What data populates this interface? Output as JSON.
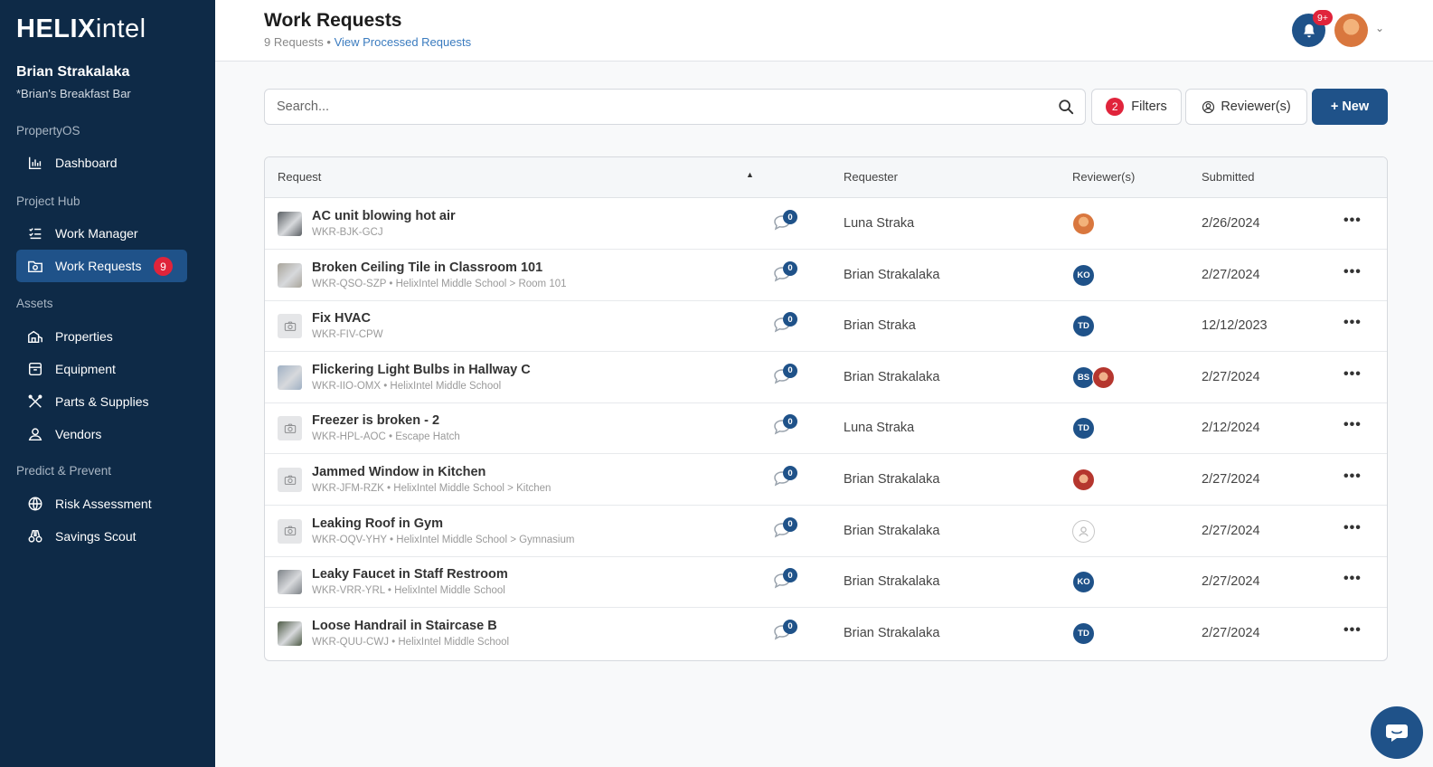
{
  "brand": {
    "logo_bold": "HELIX",
    "logo_light": "intel"
  },
  "user": {
    "name": "Brian Strakalaka",
    "org": "*Brian's Breakfast Bar"
  },
  "sidebar": {
    "sections": [
      "PropertyOS",
      "Project Hub",
      "Assets",
      "Predict & Prevent"
    ],
    "items": [
      {
        "label": "Dashboard",
        "icon": "chart-icon"
      },
      {
        "label": "Work Manager",
        "icon": "checklist-icon"
      },
      {
        "label": "Work Requests",
        "icon": "folder-camera-icon",
        "badge": "9",
        "active": true
      },
      {
        "label": "Properties",
        "icon": "buildings-icon"
      },
      {
        "label": "Equipment",
        "icon": "box-icon"
      },
      {
        "label": "Parts & Supplies",
        "icon": "tools-icon"
      },
      {
        "label": "Vendors",
        "icon": "person-icon"
      },
      {
        "label": "Risk Assessment",
        "icon": "globe-icon"
      },
      {
        "label": "Savings Scout",
        "icon": "binoculars-icon"
      }
    ]
  },
  "header": {
    "title": "Work Requests",
    "count": "9 Requests",
    "separator": "•",
    "processed_link": "View Processed Requests",
    "notif_badge": "9+"
  },
  "toolbar": {
    "search_placeholder": "Search...",
    "filters_count": "2",
    "filters_label": "Filters",
    "reviewers_label": "Reviewer(s)",
    "new_label": "+ New"
  },
  "table": {
    "columns": [
      "Request",
      "Requester",
      "Reviewer(s)",
      "Submitted"
    ],
    "rows": [
      {
        "title": "AC unit blowing hot air",
        "sub": "WKR-BJK-GCJ",
        "comments": "0",
        "requester": "Luna Straka",
        "reviewers": [
          {
            "type": "photo-a",
            "initials": ""
          }
        ],
        "submitted": "2/26/2024",
        "thumb": "photo",
        "thumb_color": "#5a5f63"
      },
      {
        "title": "Broken Ceiling Tile in Classroom 101",
        "sub": "WKR-QSO-SZP • HelixIntel Middle School > Room 101",
        "comments": "0",
        "requester": "Brian Strakalaka",
        "reviewers": [
          {
            "type": "initials",
            "initials": "KO"
          }
        ],
        "submitted": "2/27/2024",
        "thumb": "photo",
        "thumb_color": "#a8a49a"
      },
      {
        "title": "Fix HVAC",
        "sub": "WKR-FIV-CPW",
        "comments": "0",
        "requester": "Brian Straka",
        "reviewers": [
          {
            "type": "initials",
            "initials": "TD"
          }
        ],
        "submitted": "12/12/2023",
        "thumb": "placeholder",
        "thumb_color": "#e5e6e8"
      },
      {
        "title": "Flickering Light Bulbs in Hallway C",
        "sub": "WKR-IIO-OMX • HelixIntel Middle School",
        "comments": "0",
        "requester": "Brian Strakalaka",
        "reviewers": [
          {
            "type": "initials",
            "initials": "BS"
          },
          {
            "type": "photo-b",
            "initials": ""
          }
        ],
        "submitted": "2/27/2024",
        "thumb": "photo",
        "thumb_color": "#9fb0c4"
      },
      {
        "title": "Freezer is broken - 2",
        "sub": "WKR-HPL-AOC • Escape Hatch",
        "comments": "0",
        "requester": "Luna Straka",
        "reviewers": [
          {
            "type": "initials",
            "initials": "TD"
          }
        ],
        "submitted": "2/12/2024",
        "thumb": "placeholder",
        "thumb_color": "#e5e6e8"
      },
      {
        "title": "Jammed Window in Kitchen",
        "sub": "WKR-JFM-RZK • HelixIntel Middle School > Kitchen",
        "comments": "0",
        "requester": "Brian Strakalaka",
        "reviewers": [
          {
            "type": "photo-b",
            "initials": ""
          }
        ],
        "submitted": "2/27/2024",
        "thumb": "placeholder",
        "thumb_color": "#e5e6e8"
      },
      {
        "title": "Leaking Roof in Gym",
        "sub": "WKR-OQV-YHY • HelixIntel Middle School > Gymnasium",
        "comments": "0",
        "requester": "Brian Strakalaka",
        "reviewers": [
          {
            "type": "empty",
            "initials": ""
          }
        ],
        "submitted": "2/27/2024",
        "thumb": "placeholder",
        "thumb_color": "#e5e6e8"
      },
      {
        "title": "Leaky Faucet in Staff Restroom",
        "sub": "WKR-VRR-YRL • HelixIntel Middle School",
        "comments": "0",
        "requester": "Brian Strakalaka",
        "reviewers": [
          {
            "type": "initials",
            "initials": "KO"
          }
        ],
        "submitted": "2/27/2024",
        "thumb": "photo",
        "thumb_color": "#7d8287"
      },
      {
        "title": "Loose Handrail in Staircase B",
        "sub": "WKR-QUU-CWJ • HelixIntel Middle School",
        "comments": "0",
        "requester": "Brian Strakalaka",
        "reviewers": [
          {
            "type": "initials",
            "initials": "TD"
          }
        ],
        "submitted": "2/27/2024",
        "thumb": "photo",
        "thumb_color": "#4d5a45"
      }
    ],
    "row_menu": "•••"
  },
  "colors": {
    "sidebar_bg": "#0e2a47",
    "primary": "#1f5289",
    "badge_red": "#e0243b"
  }
}
